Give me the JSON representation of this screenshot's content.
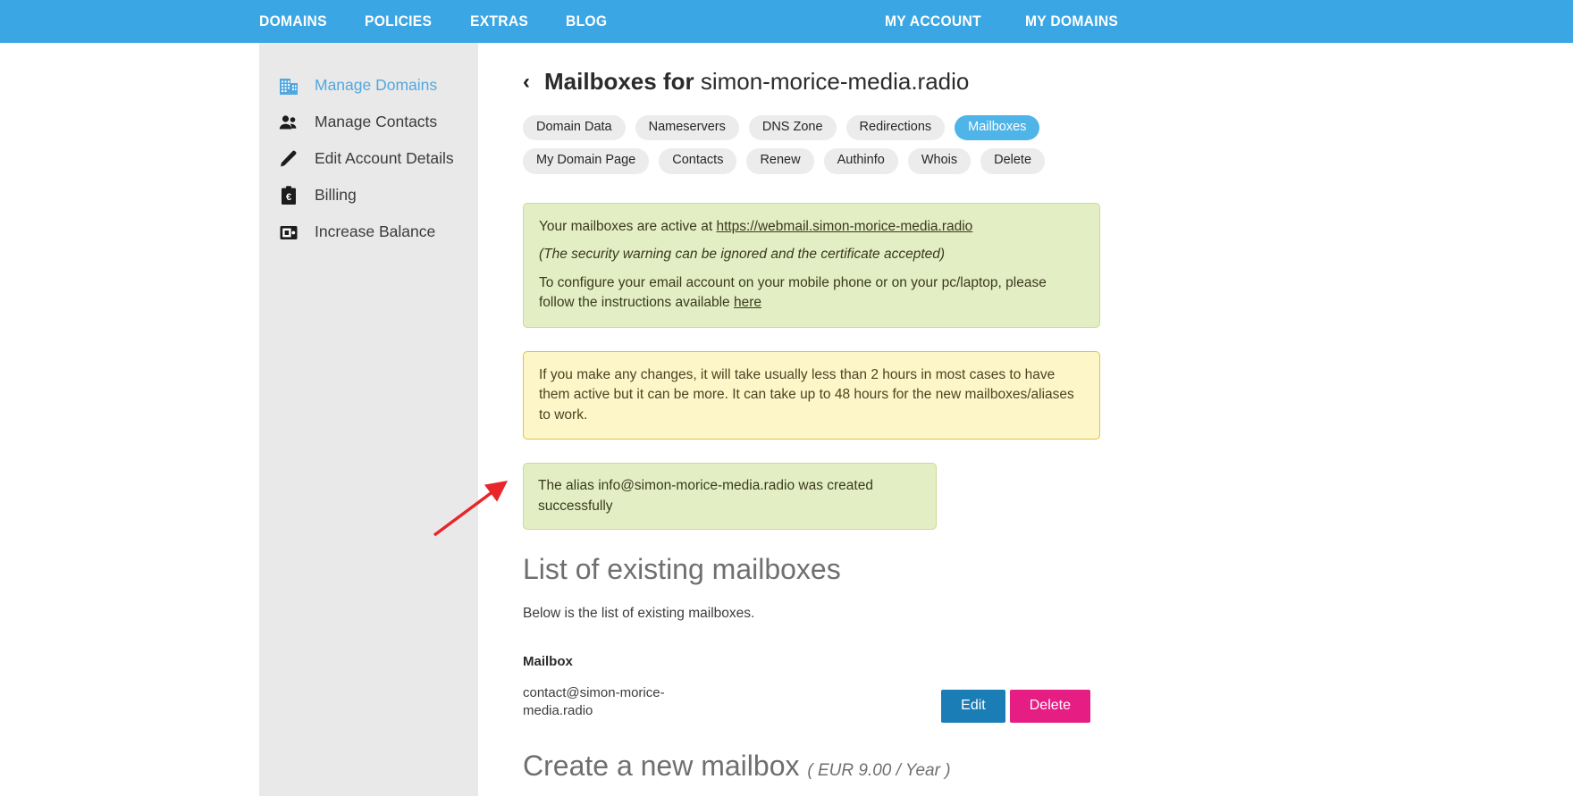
{
  "topnav": {
    "left_items": [
      {
        "label": "DOMAINS"
      },
      {
        "label": "POLICIES"
      },
      {
        "label": "EXTRAS"
      },
      {
        "label": "BLOG"
      }
    ],
    "right_items": [
      {
        "label": "MY ACCOUNT"
      },
      {
        "label": "MY DOMAINS"
      }
    ],
    "background_color": "#3aa6e3"
  },
  "sidebar": {
    "background_color": "#e9e9e9",
    "active_color": "#51a8e0",
    "items": [
      {
        "label": "Manage Domains",
        "icon": "building-icon",
        "active": true
      },
      {
        "label": "Manage Contacts",
        "icon": "people-icon",
        "active": false
      },
      {
        "label": "Edit Account Details",
        "icon": "pencil-icon",
        "active": false
      },
      {
        "label": "Billing",
        "icon": "euro-clipboard-icon",
        "active": false
      },
      {
        "label": "Increase Balance",
        "icon": "wallet-icon",
        "active": false
      }
    ]
  },
  "header": {
    "back_icon": "‹",
    "title_bold": "Mailboxes for",
    "title_domain": "simon-morice-media.radio"
  },
  "tabs": {
    "active_color": "#4fb4e8",
    "items": [
      {
        "label": "Domain Data",
        "active": false
      },
      {
        "label": "Nameservers",
        "active": false
      },
      {
        "label": "DNS Zone",
        "active": false
      },
      {
        "label": "Redirections",
        "active": false
      },
      {
        "label": "Mailboxes",
        "active": true
      },
      {
        "label": "My Domain Page",
        "active": false
      },
      {
        "label": "Contacts",
        "active": false
      },
      {
        "label": "Renew",
        "active": false
      },
      {
        "label": "Authinfo",
        "active": false
      },
      {
        "label": "Whois",
        "active": false
      },
      {
        "label": "Delete",
        "active": false
      }
    ]
  },
  "alerts": {
    "info": {
      "line1_prefix": "Your mailboxes are active at ",
      "line1_link": "https://webmail.simon-morice-media.radio",
      "line2": "(The security warning can be ignored and the certificate accepted)",
      "line3_prefix": "To configure your email account on your mobile phone or on your pc/laptop, please follow the instructions available ",
      "line3_link": "here",
      "background_color": "#e3eec5",
      "border_color": "#cbdb93"
    },
    "warning": {
      "text": "If you make any changes, it will take usually less than 2 hours in most cases to have them active but it can be more. It can take up to 48 hours for the new mailboxes/aliases to work.",
      "background_color": "#fcf6c8",
      "border_color": "#e3c43c"
    },
    "success": {
      "text": "The alias info@simon-morice-media.radio was created successfully",
      "background_color": "#e3eec5",
      "border_color": "#cbdb93"
    }
  },
  "list_section": {
    "title": "List of existing mailboxes",
    "subtitle": "Below is the list of existing mailboxes.",
    "column_header": "Mailbox",
    "rows": [
      {
        "address": "contact@simon-morice-media.radio",
        "edit_label": "Edit",
        "delete_label": "Delete"
      }
    ],
    "edit_color": "#1a7db5",
    "delete_color": "#e61e84"
  },
  "create_section": {
    "title": "Create a new mailbox",
    "price": "( EUR 9.00 / Year )"
  },
  "annotation": {
    "type": "arrow",
    "color": "#e8252a"
  }
}
